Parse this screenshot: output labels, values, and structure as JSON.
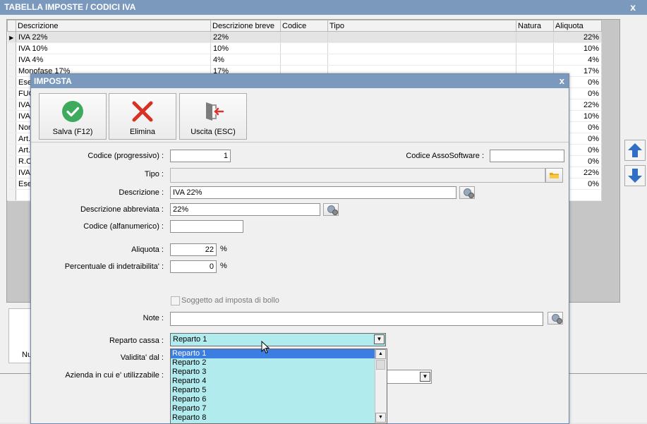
{
  "outer": {
    "title": "TABELLA IMPOSTE / CODICI IVA",
    "close": "x",
    "grid": {
      "columns": [
        "Descrizione",
        "Descrizione breve",
        "Codice",
        "Tipo",
        "Natura",
        "Aliquota"
      ],
      "rows": [
        {
          "descrizione": "IVA 22%",
          "breve": "22%",
          "aliquota": "22%"
        },
        {
          "descrizione": "IVA 10%",
          "breve": "10%",
          "aliquota": "10%"
        },
        {
          "descrizione": "IVA 4%",
          "breve": "4%",
          "aliquota": "4%"
        },
        {
          "descrizione": "Monofase 17%",
          "breve": "17%",
          "aliquota": "17%"
        },
        {
          "descrizione": "Ese",
          "breve": "",
          "aliquota": "0%"
        },
        {
          "descrizione": "FUO",
          "breve": "",
          "aliquota": "0%"
        },
        {
          "descrizione": "IVA",
          "breve": "",
          "aliquota": "22%"
        },
        {
          "descrizione": "IVA",
          "breve": "",
          "aliquota": "10%"
        },
        {
          "descrizione": "Non",
          "breve": "",
          "aliquota": "0%"
        },
        {
          "descrizione": "Art.",
          "breve": "",
          "aliquota": "0%"
        },
        {
          "descrizione": "Art.",
          "breve": "",
          "aliquota": "0%"
        },
        {
          "descrizione": "R.C",
          "breve": "",
          "aliquota": "0%"
        },
        {
          "descrizione": "IVA",
          "breve": "",
          "aliquota": "22%"
        },
        {
          "descrizione": "Ese",
          "breve": "",
          "aliquota": "0%"
        }
      ]
    },
    "bottom_label": "Nu"
  },
  "dialog": {
    "title": "IMPOSTA",
    "close": "x",
    "toolbar": {
      "save_label": "Salva (F12)",
      "delete_label": "Elimina",
      "exit_label": "Uscita (ESC)"
    },
    "form": {
      "codice_label": "Codice (progressivo) :",
      "codice_value": "1",
      "assosoftware_label": "Codice AssoSoftware :",
      "assosoftware_value": "",
      "tipo_label": "Tipo :",
      "tipo_value": "",
      "descrizione_label": "Descrizione :",
      "descrizione_value": "IVA 22%",
      "abbreviata_label": "Descrizione abbreviata :",
      "abbreviata_value": "22%",
      "alfanumerico_label": "Codice (alfanumerico) :",
      "alfanumerico_value": "",
      "aliquota_label": "Aliquota :",
      "aliquota_value": "22",
      "aliquota_unit": "%",
      "indetraibilita_label": "Percentuale di indetraibilita' :",
      "indetraibilita_value": "0",
      "indetraibilita_unit": "%",
      "bollo_label": "Soggetto ad imposta di bollo",
      "note_label": "Note :",
      "note_value": "",
      "reparto_label": "Reparto cassa :",
      "reparto_value": "Reparto 1",
      "validita_label": "Validita' dal :",
      "azienda_label": "Azienda in cui e' utilizzabile :"
    },
    "reparto_options": [
      "Reparto 1",
      "Reparto 2",
      "Reparto 3",
      "Reparto 4",
      "Reparto 5",
      "Reparto 6",
      "Reparto 7",
      "Reparto 8"
    ]
  },
  "colors": {
    "title_bar": "#7b98bd",
    "dropdown_bg": "#b2ebee",
    "list_selection": "#3b7de0",
    "check_green": "#3daa5c",
    "delete_red": "#d93025",
    "arrow_blue": "#2f6fc6"
  },
  "icons": {
    "save": "check-circle-icon",
    "delete": "x-icon",
    "exit": "door-exit-icon",
    "lookup": "globe-gear-icon",
    "folder": "folder-icon",
    "move_up": "arrow-up-icon",
    "move_down": "arrow-down-icon"
  }
}
